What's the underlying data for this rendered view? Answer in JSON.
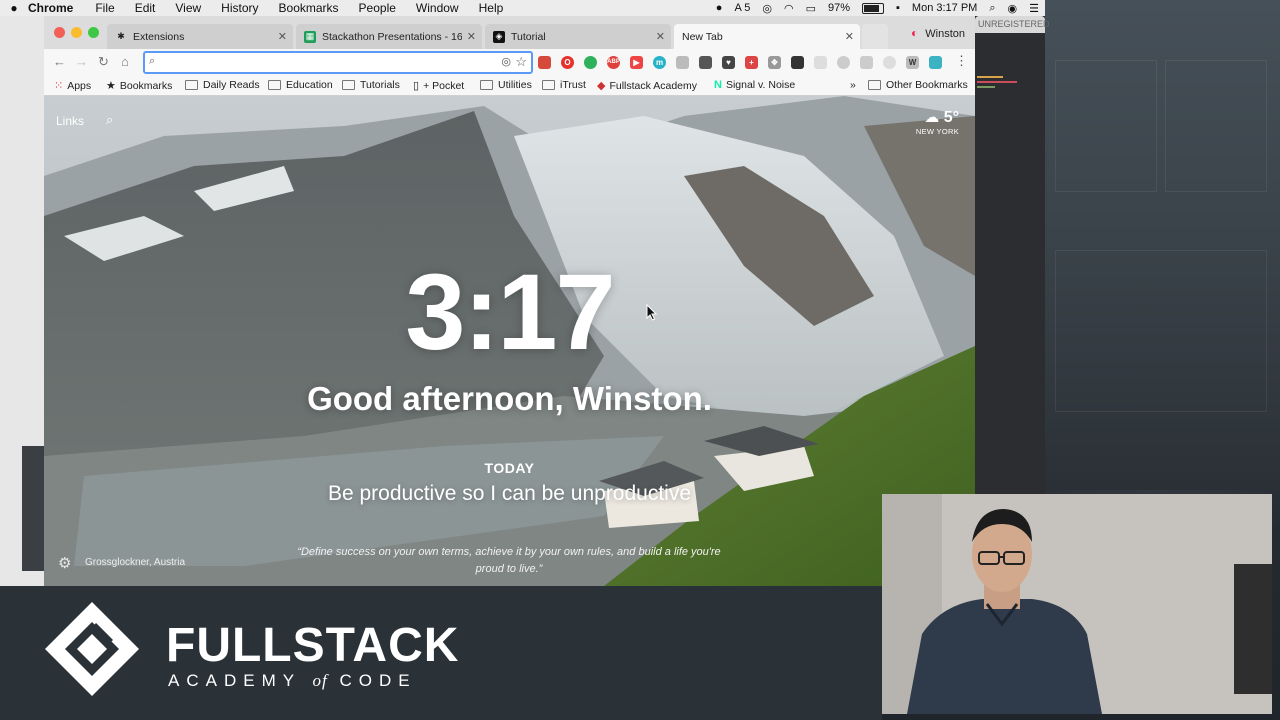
{
  "menubar": {
    "app_name": "Chrome",
    "items": [
      "File",
      "Edit",
      "View",
      "History",
      "Bookmarks",
      "People",
      "Window",
      "Help"
    ],
    "battery": "97%",
    "clock": "Mon 3:17 PM",
    "adobe_badge": "5"
  },
  "tabs": [
    {
      "label": "Extensions",
      "icon": "puzzle-icon"
    },
    {
      "label": "Stackathon Presentations - 16",
      "icon": "sheets-icon"
    },
    {
      "label": "Tutorial",
      "icon": "codepen-icon"
    },
    {
      "label": "New Tab",
      "icon": ""
    }
  ],
  "profile": {
    "name": "Winston"
  },
  "right_window": {
    "tab_label": "UNREGISTERED"
  },
  "omnibox": {
    "value": "",
    "placeholder": ""
  },
  "bookmarks": {
    "items": [
      "Apps",
      "Bookmarks",
      "Daily Reads",
      "Education",
      "Tutorials",
      "+ Pocket",
      "Utilities",
      "iTrust",
      "Fullstack Academy",
      "Signal v. Noise"
    ],
    "overflow": "»",
    "other": "Other Bookmarks"
  },
  "momentum": {
    "links_label": "Links",
    "weather_temp": "5°",
    "weather_city": "NEW YORK",
    "time": "3:17",
    "greeting": "Good afternoon, Winston.",
    "today_label": "TODAY",
    "focus": "Be productive so I can be unproductive",
    "photo_location": "Grossglockner, Austria",
    "quote": "“Define success on your own terms, achieve it by your own rules, and build a life you're proud to live.”"
  },
  "banner": {
    "title": "FULLSTACK",
    "subtitle_left": "ACADEMY",
    "subtitle_of": "of",
    "subtitle_right": "CODE"
  },
  "colors": {
    "omnibox_focus": "#5b9bf5",
    "banner_bg": "#2a3238",
    "menubar_bg": "#ececec"
  }
}
